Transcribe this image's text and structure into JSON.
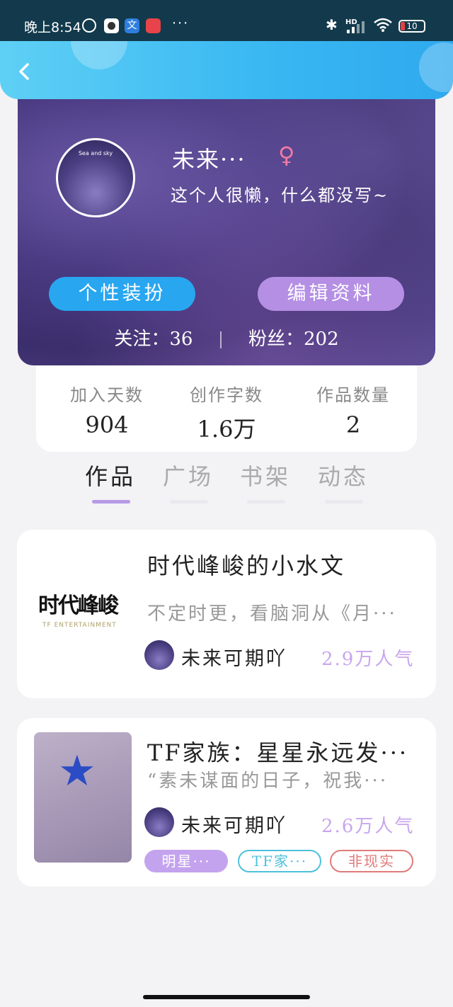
{
  "status_bar": {
    "time": "晚上8:54",
    "more": "···",
    "battery": "10",
    "app2_label": "文"
  },
  "header": {
    "back_icon": "chevron-left-icon"
  },
  "profile": {
    "nickname": "未来···",
    "gender_symbol": "♀",
    "bio": "这个人很懒，什么都没写~",
    "avatar_caption": "Sea and sky",
    "style_button": "个性装扮",
    "edit_button": "编辑资料",
    "following": "关注：36",
    "followers": "粉丝：202"
  },
  "stats": [
    {
      "label": "加入天数",
      "value": "904"
    },
    {
      "label": "创作字数",
      "value": "1.6万"
    },
    {
      "label": "作品数量",
      "value": "2"
    }
  ],
  "tabs": [
    {
      "label": "作品",
      "active": true
    },
    {
      "label": "广场",
      "active": false
    },
    {
      "label": "书架",
      "active": false
    },
    {
      "label": "动态",
      "active": false
    }
  ],
  "works": [
    {
      "title": "时代峰峻的小水文",
      "desc": "不定时更，看脑洞从《月···",
      "author": "未来可期吖",
      "popularity": "2.9万人气",
      "cover_text": "时代峰峻",
      "cover_sub": "TF ENTERTAINMENT"
    },
    {
      "title": "TF家族：星星永远发···",
      "desc": "“素未谋面的日子，祝我···",
      "author": "未来可期吖",
      "popularity": "2.6万人气",
      "tags": [
        "明星···",
        "TF家···",
        "非现实"
      ]
    }
  ],
  "colors": {
    "header_blue": "#38b7f2",
    "style_button": "#28a6f0",
    "edit_button": "#b48fe4",
    "tab_active_bar": "#b59ae6",
    "popularity": "#c9a6ec"
  }
}
